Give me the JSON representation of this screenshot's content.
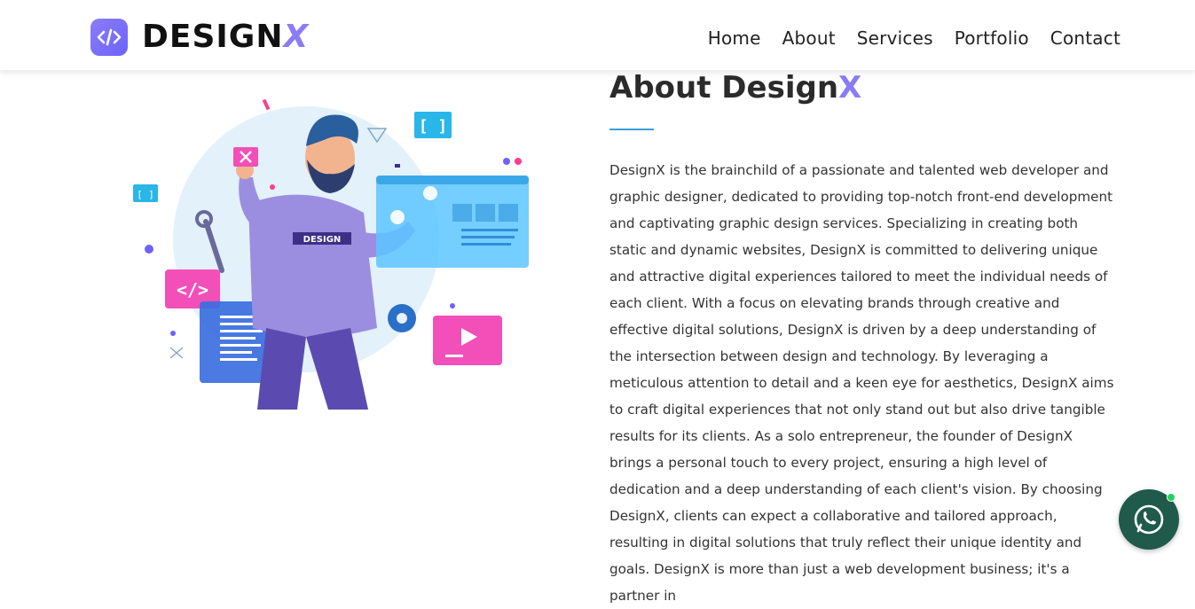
{
  "header": {
    "logo_text": "DESIGN",
    "logo_accent": "X",
    "nav": [
      "Home",
      "About",
      "Services",
      "Portfolio",
      "Contact"
    ]
  },
  "illustration": {
    "shirt_text": "DESIGN"
  },
  "about": {
    "title": "About Design",
    "title_accent": "X",
    "body": "DesignX is the brainchild of a passionate and talented web developer and graphic designer, dedicated to providing top-notch front-end development and captivating graphic design services. Specializing in creating both static and dynamic websites, DesignX is committed to delivering unique and attractive digital experiences tailored to meet the individual needs of each client. With a focus on elevating brands through creative and effective digital solutions, DesignX is driven by a deep understanding of the intersection between design and technology. By leveraging a meticulous attention to detail and a keen eye for aesthetics, DesignX aims to craft digital experiences that not only stand out but also drive tangible results for its clients. As a solo entrepreneur, the founder of DesignX brings a personal touch to every project, ensuring a high level of dedication and a deep understanding of each client's vision. By choosing DesignX, clients can expect a collaborative and tailored approach, resulting in digital solutions that truly reflect their unique identity and goals. DesignX is more than just a web development business; it's a partner in"
  },
  "colors": {
    "accent": "#8b7cf6",
    "underline": "#3aa0d8",
    "whatsapp": "#1f5a4a",
    "online_dot": "#23d15a"
  },
  "icons": [
    "code-icon",
    "whatsapp-icon"
  ]
}
